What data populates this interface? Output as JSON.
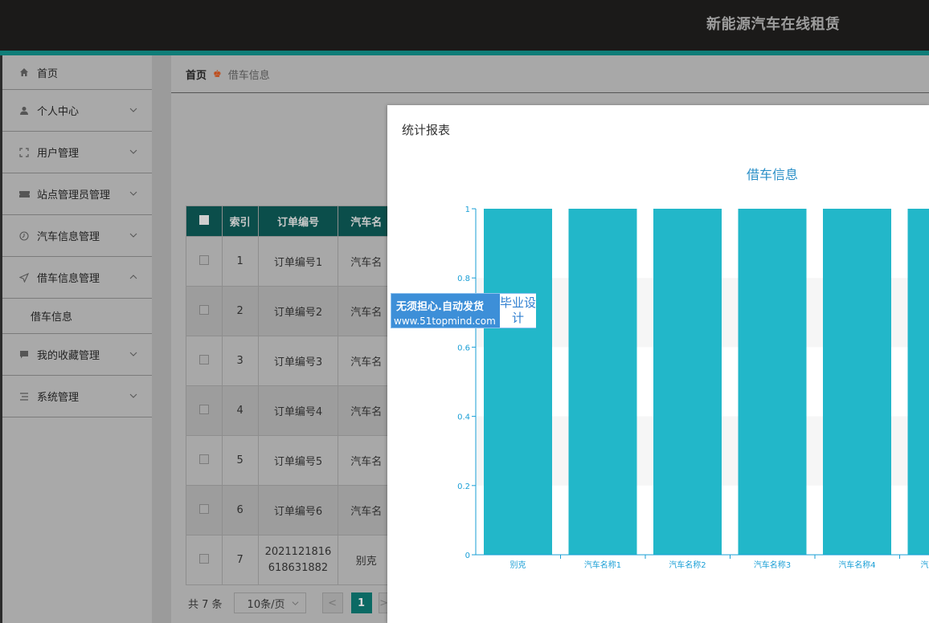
{
  "header": {
    "title": "新能源汽车在线租赁"
  },
  "sidebar": {
    "items": [
      {
        "label": "首页",
        "icon": "home-icon"
      },
      {
        "label": "个人中心",
        "icon": "user-icon"
      },
      {
        "label": "用户管理",
        "icon": "expand-icon"
      },
      {
        "label": "站点管理员管理",
        "icon": "ticket-icon"
      },
      {
        "label": "汽车信息管理",
        "icon": "clock-icon"
      },
      {
        "label": "借车信息管理",
        "icon": "send-icon",
        "sub": "借车信息"
      },
      {
        "label": "我的收藏管理",
        "icon": "comment-icon"
      },
      {
        "label": "系统管理",
        "icon": "list-icon"
      }
    ]
  },
  "breadcrumb": {
    "home": "首页",
    "current": "借车信息"
  },
  "table": {
    "headers": [
      "索引",
      "订单编号",
      "汽车名"
    ],
    "rows": [
      [
        "1",
        "订单编号1",
        "汽车名"
      ],
      [
        "2",
        "订单编号2",
        "汽车名"
      ],
      [
        "3",
        "订单编号3",
        "汽车名"
      ],
      [
        "4",
        "订单编号4",
        "汽车名"
      ],
      [
        "5",
        "订单编号5",
        "汽车名"
      ],
      [
        "6",
        "订单编号6",
        "汽车名"
      ],
      [
        "7",
        "2021121816 618631882",
        "别克"
      ]
    ]
  },
  "pagination": {
    "total": "共 7 条",
    "page_size": "10条/页",
    "current_page": "1",
    "prev": "<",
    "next": ">"
  },
  "modal": {
    "title": "统计报表"
  },
  "watermark": {
    "line1": "无须担心.自动发货",
    "line2": "www.51topmind.com",
    "box": "毕业设计"
  },
  "colors": {
    "bar": "#22b7c9",
    "axis": "#1a9fd6",
    "header_bg": "#1b1a19",
    "accent": "#0f7d78"
  },
  "chart_data": {
    "type": "bar",
    "title": "借车信息",
    "categories": [
      "别克",
      "汽车名称1",
      "汽车名称2",
      "汽车名称3",
      "汽车名称4",
      "汽"
    ],
    "values": [
      1,
      1,
      1,
      1,
      1,
      1
    ],
    "yticks": [
      "0",
      "0.2",
      "0.4",
      "0.6",
      "0.8",
      "1"
    ],
    "ylim": [
      0,
      1
    ],
    "grid": true
  }
}
